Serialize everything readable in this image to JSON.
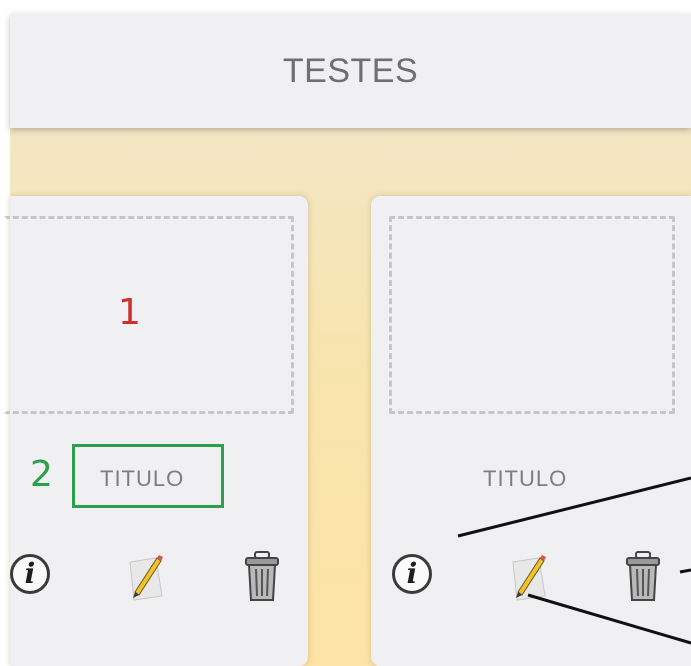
{
  "header": {
    "title": "TESTES"
  },
  "cards": [
    {
      "title": "TITULO"
    },
    {
      "title": "TITULO"
    }
  ],
  "annotations": {
    "marker_1": "1",
    "marker_2": "2"
  },
  "icons": {
    "info": "info-icon",
    "edit": "pencil-edit-icon",
    "delete": "trash-icon"
  },
  "colors": {
    "marker_1": "#d0302c",
    "marker_2": "#2ca04a",
    "board": "#f7e4ad",
    "card": "#f0f0f2"
  }
}
